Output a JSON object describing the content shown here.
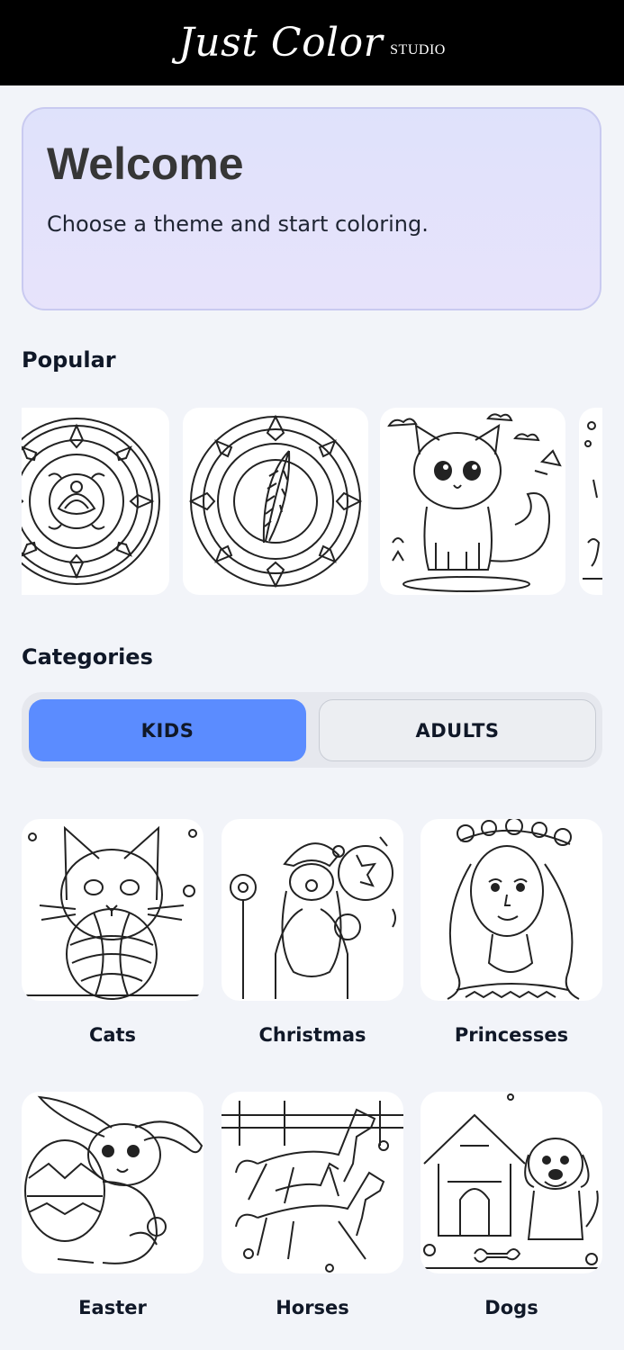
{
  "header": {
    "logo_main": "Just Color",
    "logo_sub": "STUDIO"
  },
  "welcome": {
    "title": "Welcome",
    "subtitle": "Choose a theme and start coloring."
  },
  "popular": {
    "title": "Popular",
    "items": [
      {
        "icon": "mandala-lotus-icon"
      },
      {
        "icon": "mandala-feather-icon"
      },
      {
        "icon": "kitten-scene-icon"
      },
      {
        "icon": "partial-illustration-icon"
      }
    ]
  },
  "categories": {
    "title": "Categories",
    "tabs": [
      {
        "label": "KIDS",
        "selected": true
      },
      {
        "label": "ADULTS",
        "selected": false
      }
    ],
    "items": [
      {
        "label": "Cats",
        "icon": "cat-icon"
      },
      {
        "label": "Christmas",
        "icon": "santa-icon"
      },
      {
        "label": "Princesses",
        "icon": "princess-icon"
      },
      {
        "label": "Easter",
        "icon": "easter-bunny-icon"
      },
      {
        "label": "Horses",
        "icon": "horses-icon"
      },
      {
        "label": "Dogs",
        "icon": "dog-icon"
      }
    ]
  },
  "colors": {
    "header_bg": "#000000",
    "page_bg": "#f2f4f9",
    "welcome_bg": "#dfe2fb",
    "accent": "#5b8cff"
  }
}
